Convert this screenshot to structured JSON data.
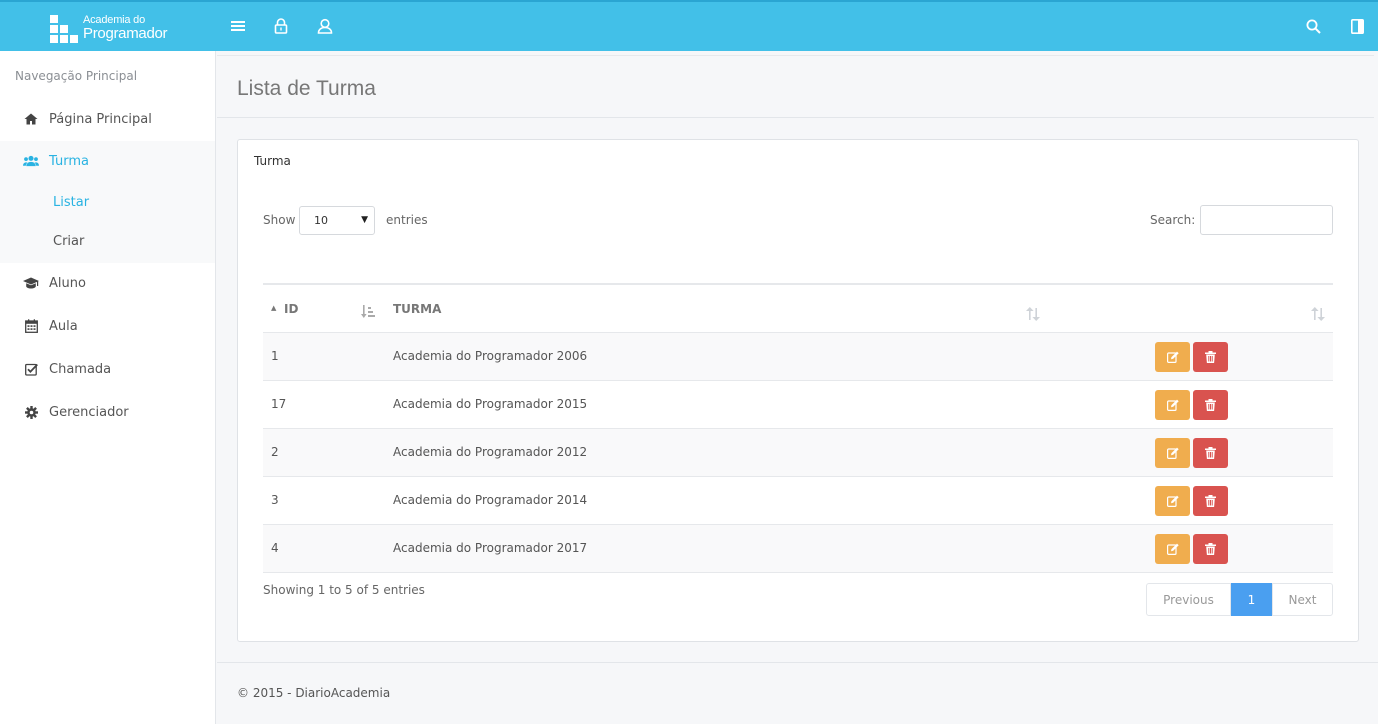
{
  "brand": {
    "line1": "Academia do",
    "line2": "Programador"
  },
  "topbar_icons": [
    "menu-icon",
    "lock-icon",
    "user-icon",
    "search-icon",
    "sidebar-toggle-icon"
  ],
  "sidebar": {
    "title": "Navegação Principal",
    "items": [
      {
        "label": "Página Principal",
        "icon": "home-icon"
      },
      {
        "label": "Turma",
        "icon": "users-icon",
        "active": true
      },
      {
        "label": "Aluno",
        "icon": "graduation-cap-icon"
      },
      {
        "label": "Aula",
        "icon": "calendar-icon"
      },
      {
        "label": "Chamada",
        "icon": "check-square-icon"
      },
      {
        "label": "Gerenciador",
        "icon": "gear-icon"
      }
    ],
    "subitems": [
      {
        "label": "Listar",
        "active": true
      },
      {
        "label": "Criar"
      }
    ]
  },
  "page": {
    "title": "Lista de Turma"
  },
  "panel": {
    "title": "Turma"
  },
  "table_controls": {
    "show_label": "Show",
    "length_value": "10",
    "entries_label": "entries",
    "search_label": "Search:",
    "search_value": ""
  },
  "table": {
    "columns": [
      "ID",
      "TURMA"
    ],
    "rows": [
      {
        "id": "1",
        "turma": "Academia do Programador 2006"
      },
      {
        "id": "17",
        "turma": "Academia do Programador 2015"
      },
      {
        "id": "2",
        "turma": "Academia do Programador 2012"
      },
      {
        "id": "3",
        "turma": "Academia do Programador 2014"
      },
      {
        "id": "4",
        "turma": "Academia do Programador 2017"
      }
    ]
  },
  "info": "Showing 1 to 5 of 5 entries",
  "pagination": {
    "previous": "Previous",
    "current": "1",
    "next": "Next"
  },
  "footer": {
    "text": "© 2015 - DiarioAcademia"
  },
  "colors": {
    "topbar": "#42c0e8",
    "accent": "#29b3e2",
    "edit_button": "#f0ad4e",
    "delete_button": "#d9534f",
    "active_page": "#4a9ff0"
  }
}
